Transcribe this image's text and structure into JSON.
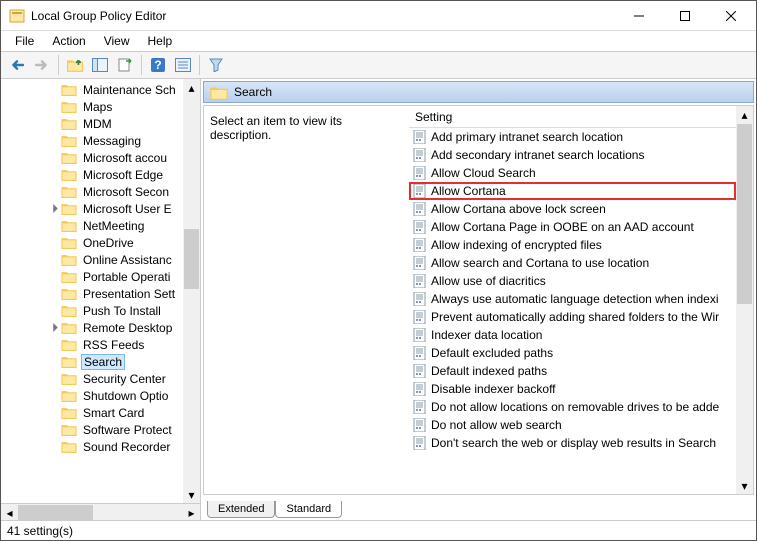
{
  "window": {
    "title": "Local Group Policy Editor"
  },
  "menu": {
    "file": "File",
    "action": "Action",
    "view": "View",
    "help": "Help"
  },
  "tree": {
    "items": [
      {
        "label": "Maintenance Sch",
        "caret": false
      },
      {
        "label": "Maps",
        "caret": false
      },
      {
        "label": "MDM",
        "caret": false
      },
      {
        "label": "Messaging",
        "caret": false
      },
      {
        "label": "Microsoft accou",
        "caret": false
      },
      {
        "label": "Microsoft Edge",
        "caret": false
      },
      {
        "label": "Microsoft Secon",
        "caret": false
      },
      {
        "label": "Microsoft User E",
        "caret": true
      },
      {
        "label": "NetMeeting",
        "caret": false
      },
      {
        "label": "OneDrive",
        "caret": false
      },
      {
        "label": "Online Assistanc",
        "caret": false
      },
      {
        "label": "Portable Operati",
        "caret": false
      },
      {
        "label": "Presentation Sett",
        "caret": false
      },
      {
        "label": "Push To Install",
        "caret": false
      },
      {
        "label": "Remote Desktop",
        "caret": true
      },
      {
        "label": "RSS Feeds",
        "caret": false
      },
      {
        "label": "Search",
        "caret": false,
        "selected": true
      },
      {
        "label": "Security Center",
        "caret": false
      },
      {
        "label": "Shutdown Optio",
        "caret": false
      },
      {
        "label": "Smart Card",
        "caret": false
      },
      {
        "label": "Software Protect",
        "caret": false
      },
      {
        "label": "Sound Recorder",
        "caret": false
      }
    ]
  },
  "right": {
    "heading": "Search",
    "description": "Select an item to view its description.",
    "column": "Setting",
    "settings": [
      {
        "label": "Add primary intranet search location"
      },
      {
        "label": "Add secondary intranet search locations"
      },
      {
        "label": "Allow Cloud Search"
      },
      {
        "label": "Allow Cortana",
        "highlight": true
      },
      {
        "label": "Allow Cortana above lock screen"
      },
      {
        "label": "Allow Cortana Page in OOBE on an AAD account"
      },
      {
        "label": "Allow indexing of encrypted files"
      },
      {
        "label": "Allow search and Cortana to use location"
      },
      {
        "label": "Allow use of diacritics"
      },
      {
        "label": "Always use automatic language detection when indexi"
      },
      {
        "label": "Prevent automatically adding shared folders to the Wir"
      },
      {
        "label": "Indexer data location"
      },
      {
        "label": "Default excluded paths"
      },
      {
        "label": "Default indexed paths"
      },
      {
        "label": "Disable indexer backoff"
      },
      {
        "label": "Do not allow locations on removable drives to be adde"
      },
      {
        "label": "Do not allow web search"
      },
      {
        "label": "Don't search the web or display web results in Search"
      }
    ]
  },
  "tabs": {
    "extended": "Extended",
    "standard": "Standard"
  },
  "status": {
    "text": "41 setting(s)"
  }
}
